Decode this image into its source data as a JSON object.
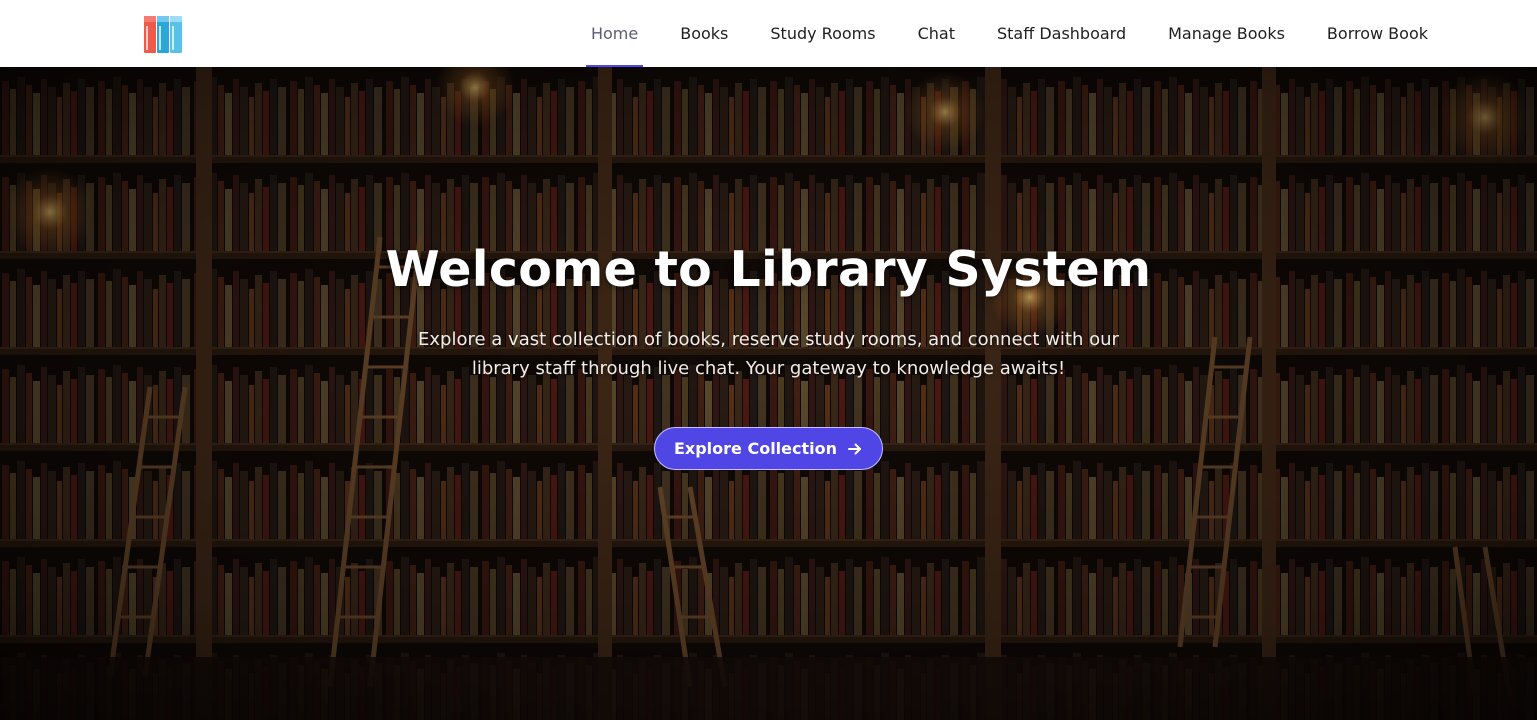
{
  "brand": {
    "logo_icon": "books-logo-icon",
    "colors": [
      "#ef5a4a",
      "#2aa7d9",
      "#57c1e8"
    ]
  },
  "nav": {
    "items": [
      {
        "label": "Home",
        "active": true
      },
      {
        "label": "Books",
        "active": false
      },
      {
        "label": "Study Rooms",
        "active": false
      },
      {
        "label": "Chat",
        "active": false
      },
      {
        "label": "Staff Dashboard",
        "active": false
      },
      {
        "label": "Manage Books",
        "active": false
      },
      {
        "label": "Borrow Book",
        "active": false
      }
    ],
    "active_color": "#4f46e5"
  },
  "hero": {
    "title": "Welcome to Library System",
    "subtitle": "Explore a vast collection of books, reserve study rooms, and connect with our library staff through live chat. Your gateway to knowledge awaits!",
    "button_label": "Explore Collection",
    "button_icon": "arrow-right-icon",
    "button_color": "#4f46e5",
    "background": "library-bookshelves-with-ladders"
  }
}
